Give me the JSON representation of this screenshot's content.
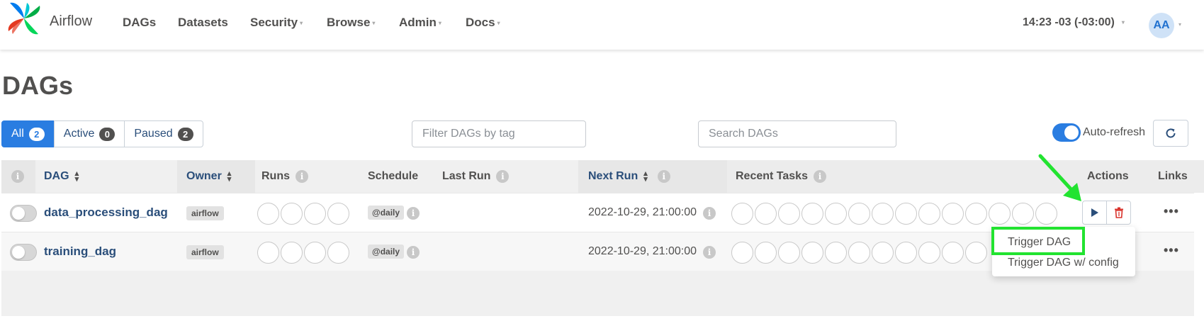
{
  "navbar": {
    "brand": "Airflow",
    "items": [
      "DAGs",
      "Datasets",
      "Security",
      "Browse",
      "Admin",
      "Docs"
    ],
    "time": "14:23 -03 (-03:00)",
    "avatar_initials": "AA"
  },
  "page": {
    "title": "DAGs"
  },
  "filters": {
    "status": [
      {
        "label": "All",
        "count": "2"
      },
      {
        "label": "Active",
        "count": "0"
      },
      {
        "label": "Paused",
        "count": "2"
      }
    ],
    "tag_placeholder": "Filter DAGs by tag",
    "search_placeholder": "Search DAGs",
    "autorefresh_label": "Auto-refresh"
  },
  "table": {
    "headers": {
      "dag": "DAG",
      "owner": "Owner",
      "runs": "Runs",
      "schedule": "Schedule",
      "last_run": "Last Run",
      "next_run": "Next Run",
      "recent_tasks": "Recent Tasks",
      "actions": "Actions",
      "links": "Links"
    },
    "rows": [
      {
        "name": "data_processing_dag",
        "owner": "airflow",
        "schedule": "@daily",
        "next_run": "2022-10-29, 21:00:00"
      },
      {
        "name": "training_dag",
        "owner": "airflow",
        "schedule": "@daily",
        "next_run": "2022-10-29, 21:00:00"
      }
    ]
  },
  "dropdown": {
    "items": [
      "Trigger DAG",
      "Trigger DAG w/ config"
    ]
  },
  "colors": {
    "primary": "#2a7de1",
    "link": "#2a4e7a",
    "highlight": "#22e330",
    "delete": "#d9322b"
  }
}
